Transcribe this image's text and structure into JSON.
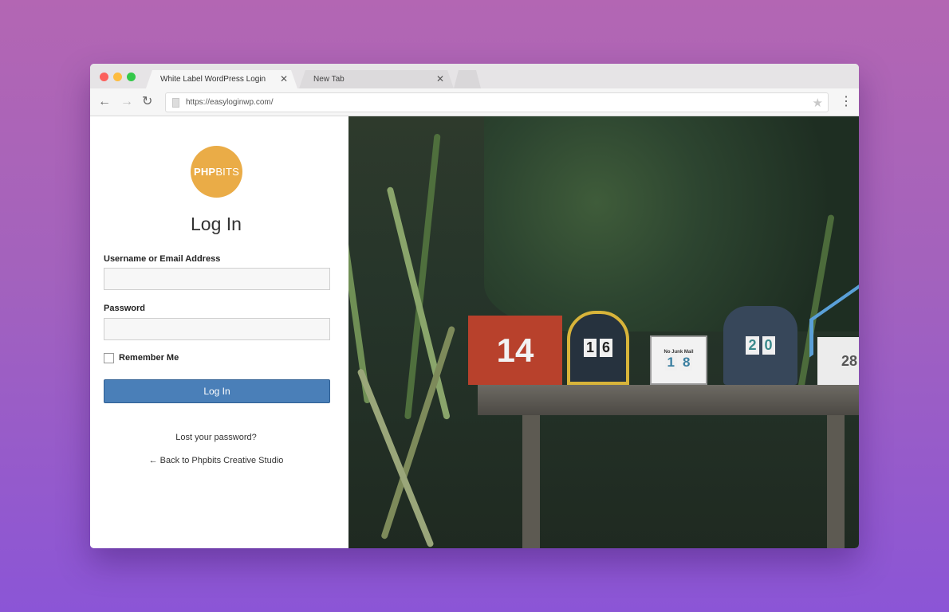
{
  "browser": {
    "tabs": [
      {
        "label": "White Label WordPress Login Page",
        "active": true
      },
      {
        "label": "New Tab",
        "active": false
      }
    ],
    "address": "https://easyloginwp.com/"
  },
  "login": {
    "logo": {
      "bold": "PHP",
      "light": "BITS",
      "color": "#eaac47"
    },
    "title": "Log In",
    "username_label": "Username or Email Address",
    "username_value": "",
    "password_label": "Password",
    "password_value": "",
    "remember_label": "Remember Me",
    "remember_checked": false,
    "submit_label": "Log In",
    "submit_color": "#4a7fb8",
    "lost_password": "Lost your password?",
    "back_link": "← Back to Phpbits Creative Studio"
  },
  "photo": {
    "mailboxes": [
      {
        "number": "14",
        "color": "#b8412c"
      },
      {
        "digits": [
          "1",
          "6"
        ],
        "color": "#26323e"
      },
      {
        "small_label": "No Junk Mail",
        "digits": [
          "1",
          "8"
        ],
        "color": "#f2f2f2"
      },
      {
        "digits": [
          "2",
          "0"
        ],
        "color": "#37475a"
      },
      {
        "number": "28",
        "color": "#ececec"
      }
    ]
  }
}
